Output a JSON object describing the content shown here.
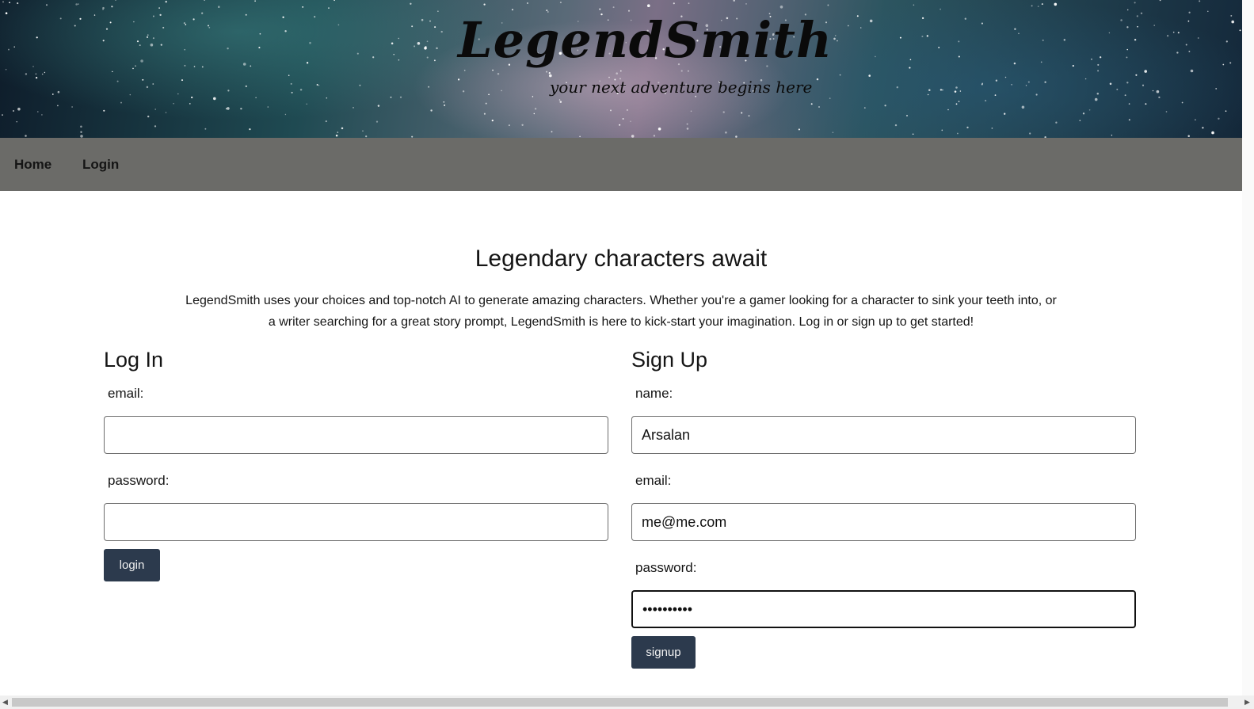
{
  "banner": {
    "logo": "LegendSmith",
    "tagline": "your next adventure begins here"
  },
  "nav": {
    "home": "Home",
    "login": "Login"
  },
  "intro": {
    "title": "Legendary characters await",
    "text": "LegendSmith uses your choices and top-notch AI to generate amazing characters. Whether you're a gamer looking for a character to sink your teeth into, or a writer searching for a great story prompt, LegendSmith is here to kick-start your imagination. Log in or sign up to get started!"
  },
  "login": {
    "title": "Log In",
    "email_label": "email:",
    "email_value": "",
    "password_label": "password:",
    "password_value": "",
    "button": "login"
  },
  "signup": {
    "title": "Sign Up",
    "name_label": "name:",
    "name_value": "Arsalan",
    "email_label": "email:",
    "email_value": "me@me.com",
    "password_label": "password:",
    "password_value": "••••••••••",
    "button": "signup"
  },
  "colors": {
    "navbar": "#6b6b68",
    "button": "#2c3a4d"
  },
  "icons": {
    "scroll_left": "scroll-left-arrow-icon",
    "scroll_right": "scroll-right-arrow-icon"
  }
}
